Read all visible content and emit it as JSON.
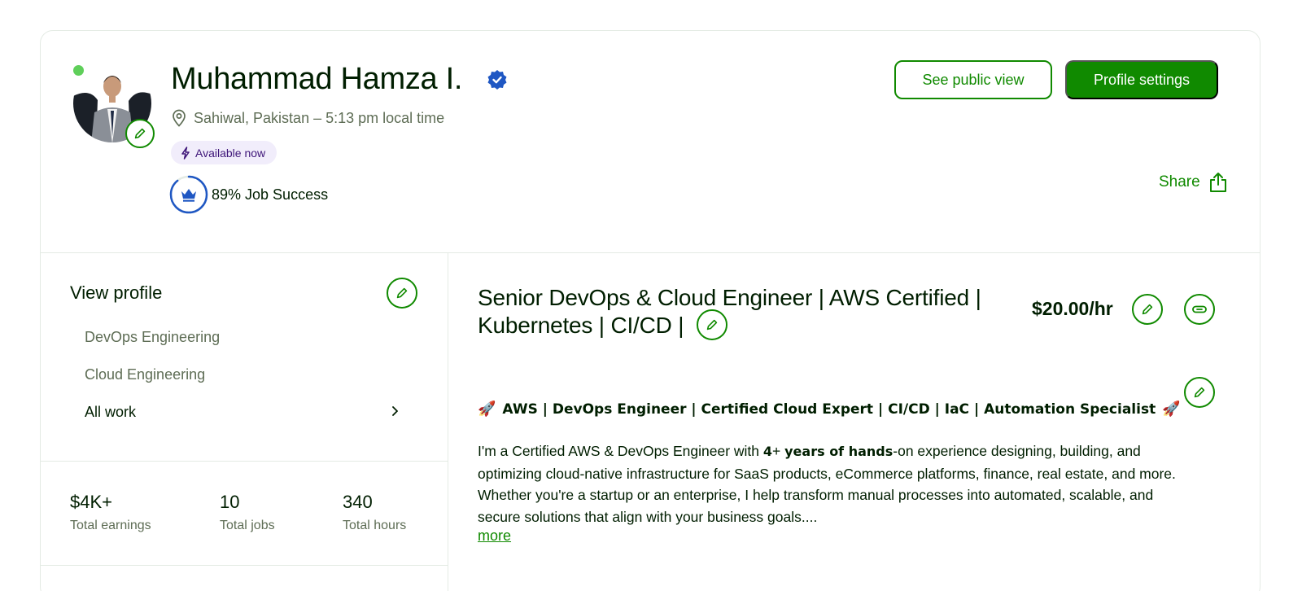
{
  "profile": {
    "name": "Muhammad Hamza I.",
    "location": "Sahiwal, Pakistan – 5:13 pm local time",
    "availability": "Available now",
    "job_success": "89% Job Success",
    "job_success_pct": 89
  },
  "actions": {
    "public_view": "See public view",
    "settings": "Profile settings",
    "share": "Share"
  },
  "sidebar": {
    "view_profile": "View profile",
    "items": [
      {
        "label": "DevOps Engineering"
      },
      {
        "label": "Cloud Engineering"
      },
      {
        "label": "All work"
      }
    ]
  },
  "stats": [
    {
      "value": "$4K+",
      "label": "Total earnings"
    },
    {
      "value": "10",
      "label": "Total jobs"
    },
    {
      "value": "340",
      "label": "Total hours"
    }
  ],
  "main": {
    "title_line1": "Senior DevOps & Cloud Engineer | AWS Certified |",
    "title_line2": "Kubernetes | CI/CD |",
    "rate": "$20.00/hr",
    "headline": "AWS | DevOps Engineer | Certified Cloud Expert | CI/CD | IaC | Automation Specialist",
    "overview_1": "I'm a Certified AWS & DevOps Engineer with ",
    "overview_bold_1": "4",
    "overview_2": "+ ",
    "overview_bold_2": "years of hands",
    "overview_3": "-on experience designing, building, and optimizing cloud-native infrastructure for SaaS products, eCommerce platforms, finance, real estate, and more. Whether you're a startup or an enterprise, I help transform manual processes into automated, scalable, and secure solutions that align with your business goals....",
    "more": "more"
  },
  "colors": {
    "brand_green": "#108a00",
    "verified_blue": "#1f57c3",
    "online": "#5fcf5a",
    "available_bg": "#f1edfb"
  }
}
